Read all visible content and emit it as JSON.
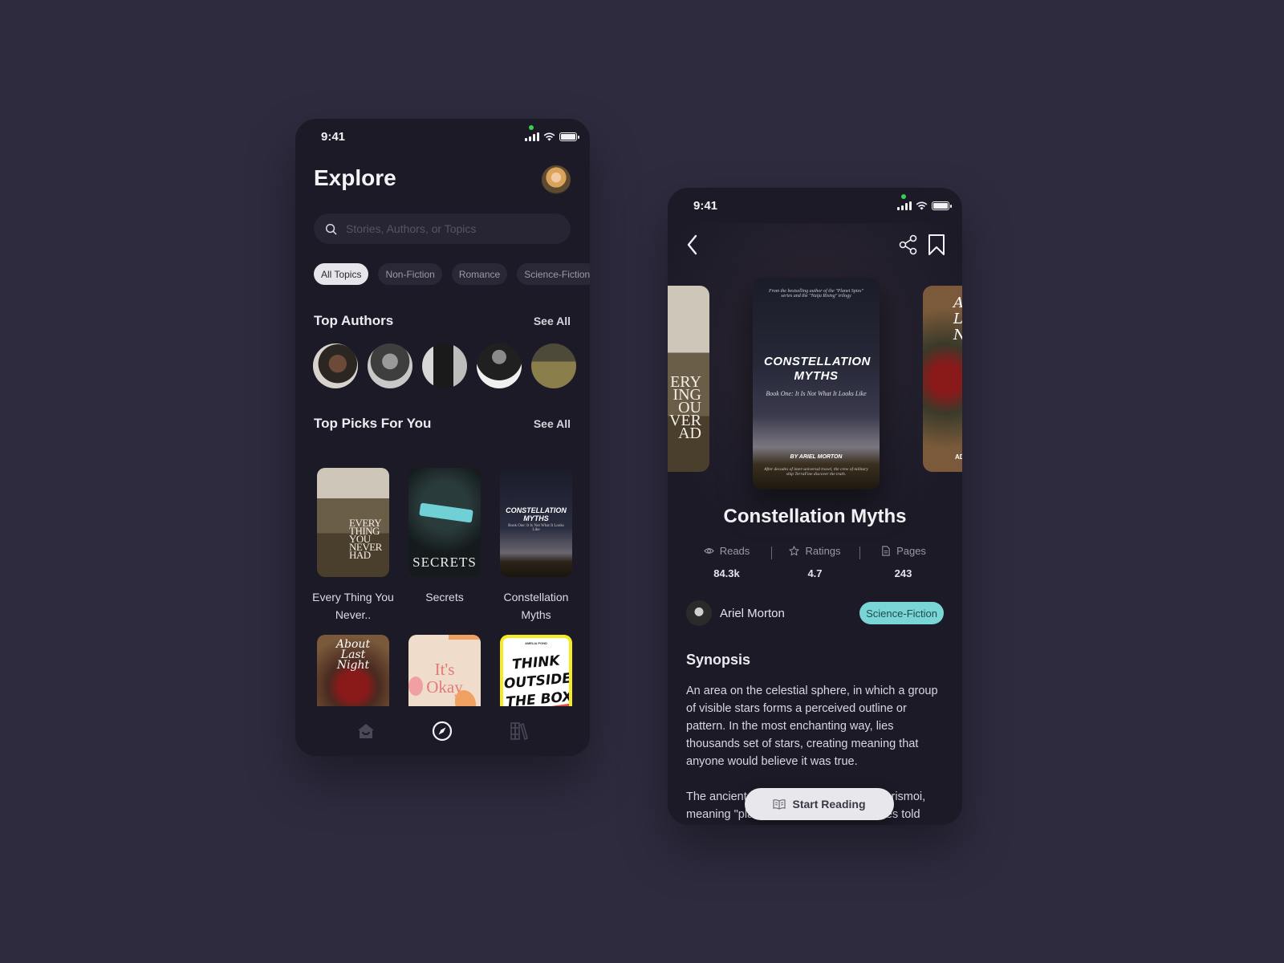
{
  "explore_screen": {
    "status_bar": {
      "time": "9:41"
    },
    "title": "Explore",
    "search": {
      "placeholder": "Stories, Authors, or Topics",
      "value": ""
    },
    "topics": [
      {
        "label": "All Topics",
        "active": true
      },
      {
        "label": "Non-Fiction",
        "active": false
      },
      {
        "label": "Romance",
        "active": false
      },
      {
        "label": "Science-Fiction",
        "active": false
      }
    ],
    "top_authors": {
      "title": "Top Authors",
      "see_all": "See All",
      "count": 5
    },
    "top_picks": {
      "title": "Top Picks For You",
      "see_all": "See All",
      "books": [
        {
          "title": "Every Thing You Never..",
          "cover_text": "EVERY THING YOU NEVER HAD"
        },
        {
          "title": "Secrets",
          "cover_text": "SECRETS"
        },
        {
          "title": "Constellation Myths",
          "cover_text": "CONSTELLATION MYTHS",
          "cover_sub": "Book One: It Is Not What It Looks Like"
        }
      ],
      "more_books": [
        {
          "cover_text": "About Last Night"
        },
        {
          "cover_text": "It's Okay"
        },
        {
          "cover_text": "THINK OUTSIDE THE BOX",
          "cover_author": "AMELIA POND"
        }
      ]
    },
    "bottom_nav": [
      {
        "name": "home",
        "icon": "home-icon",
        "active": false
      },
      {
        "name": "explore",
        "icon": "compass-icon",
        "active": true
      },
      {
        "name": "library",
        "icon": "books-icon",
        "active": false
      }
    ]
  },
  "detail_screen": {
    "status_bar": {
      "time": "9:41"
    },
    "carousel": {
      "main_cover": {
        "top_text": "From the bestselling author of the \"Planet Spies\" series and the \"Naija Rising\" trilogy",
        "title": "CONSTELLATION MYTHS",
        "subtitle": "Book One: It Is Not What It Looks Like",
        "byline": "BY ARIEL MORTON",
        "blurb": "After decades of inter-universal travel, the crew of military ship TerraFine discover the truth."
      },
      "left_cover_text": "ERY ING OU VER AD",
      "right_cover_text": "A L N",
      "right_cover_byline": "AD"
    },
    "book_title": "Constellation Myths",
    "stats": [
      {
        "label": "Reads",
        "value": "84.3k",
        "icon": "eye-icon"
      },
      {
        "label": "Ratings",
        "value": "4.7",
        "icon": "star-icon"
      },
      {
        "label": "Pages",
        "value": "243",
        "icon": "document-icon"
      }
    ],
    "author": "Ariel Morton",
    "genre": "Science-Fiction",
    "synopsis_title": "Synopsis",
    "synopsis": [
      "An area on the celestial sphere, in which a group of visible stars forms a perceived outline or pattern. In the most enchanting way, lies thousands set of stars, creating meaning that anyone would believe it was true.",
      "The ancient Greeks called them katasterismoi, meaning \"placings of the stars\" — stories told across the night sky."
    ],
    "start_button": "Start Reading"
  },
  "colors": {
    "background": "#2e2b3f",
    "phone_bg": "#1c1a26",
    "accent_teal": "#7ad6d6",
    "status_dot": "#35d04f"
  }
}
